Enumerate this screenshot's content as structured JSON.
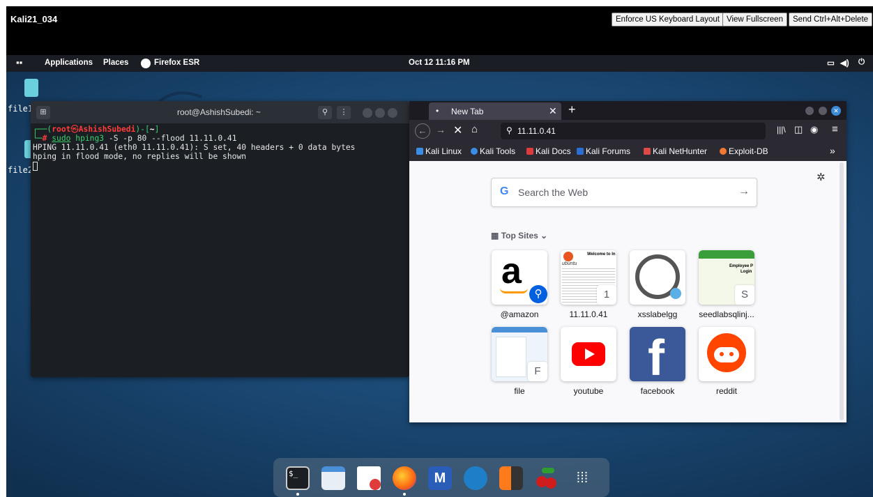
{
  "vm": {
    "title": "Kali21_034",
    "buttons": [
      "Enforce US Keyboard Layout",
      "View Fullscreen",
      "Send Ctrl+Alt+Delete"
    ]
  },
  "panel": {
    "applications": "Applications",
    "places": "Places",
    "firefox": "Firefox ESR",
    "clock": "Oct 12  11:16 PM"
  },
  "desktop_icons": [
    "file1",
    "file2"
  ],
  "terminal": {
    "title": "root@AshishSubedi: ~",
    "prompt_user": "root",
    "prompt_host": "AshishSubedi",
    "prompt_dir": "~",
    "command_sudo": "sudo",
    "command_bin": "hping3",
    "command_args": "-S -p 80 --flood 11.11.0.41",
    "output": [
      "HPING 11.11.0.41 (eth0 11.11.0.41): S set, 40 headers + 0 data bytes",
      "hping in flood mode, no replies will be shown"
    ]
  },
  "firefox": {
    "tab_title": "New Tab",
    "url": "11.11.0.41",
    "bookmarks": [
      "Kali Linux",
      "Kali Tools",
      "Kali Docs",
      "Kali Forums",
      "Kali NetHunter",
      "Exploit-DB"
    ],
    "search_placeholder": "Search the Web",
    "top_sites_label": "Top Sites",
    "tiles": [
      {
        "label": "@amazon",
        "badge": ""
      },
      {
        "label": "11.11.0.41",
        "badge": "1"
      },
      {
        "label": "xsslabelgg",
        "badge": ""
      },
      {
        "label": "seedlabsqlinj...",
        "badge": "S"
      },
      {
        "label": "file",
        "badge": "F"
      },
      {
        "label": "youtube",
        "badge": ""
      },
      {
        "label": "facebook",
        "badge": ""
      },
      {
        "label": "reddit",
        "badge": ""
      }
    ],
    "tile_text": {
      "ubuntu_welcome": "Welcome to In",
      "ubuntu": "ubuntu",
      "employee_p": "Employee P",
      "login": "Login"
    }
  },
  "colors": {
    "desktop": "#1c4b78",
    "panel": "#1a1e24",
    "prompt_green": "#3bd16f",
    "prompt_red": "#ff3b3b",
    "ff_dark": "#1c1b22"
  },
  "dock": [
    "terminal-icon",
    "files-icon",
    "text-editor-icon",
    "firefox-icon",
    "metasploit-icon",
    "wireshark-icon",
    "burpsuite-icon",
    "cherrytree-icon",
    "app-grid-icon"
  ]
}
